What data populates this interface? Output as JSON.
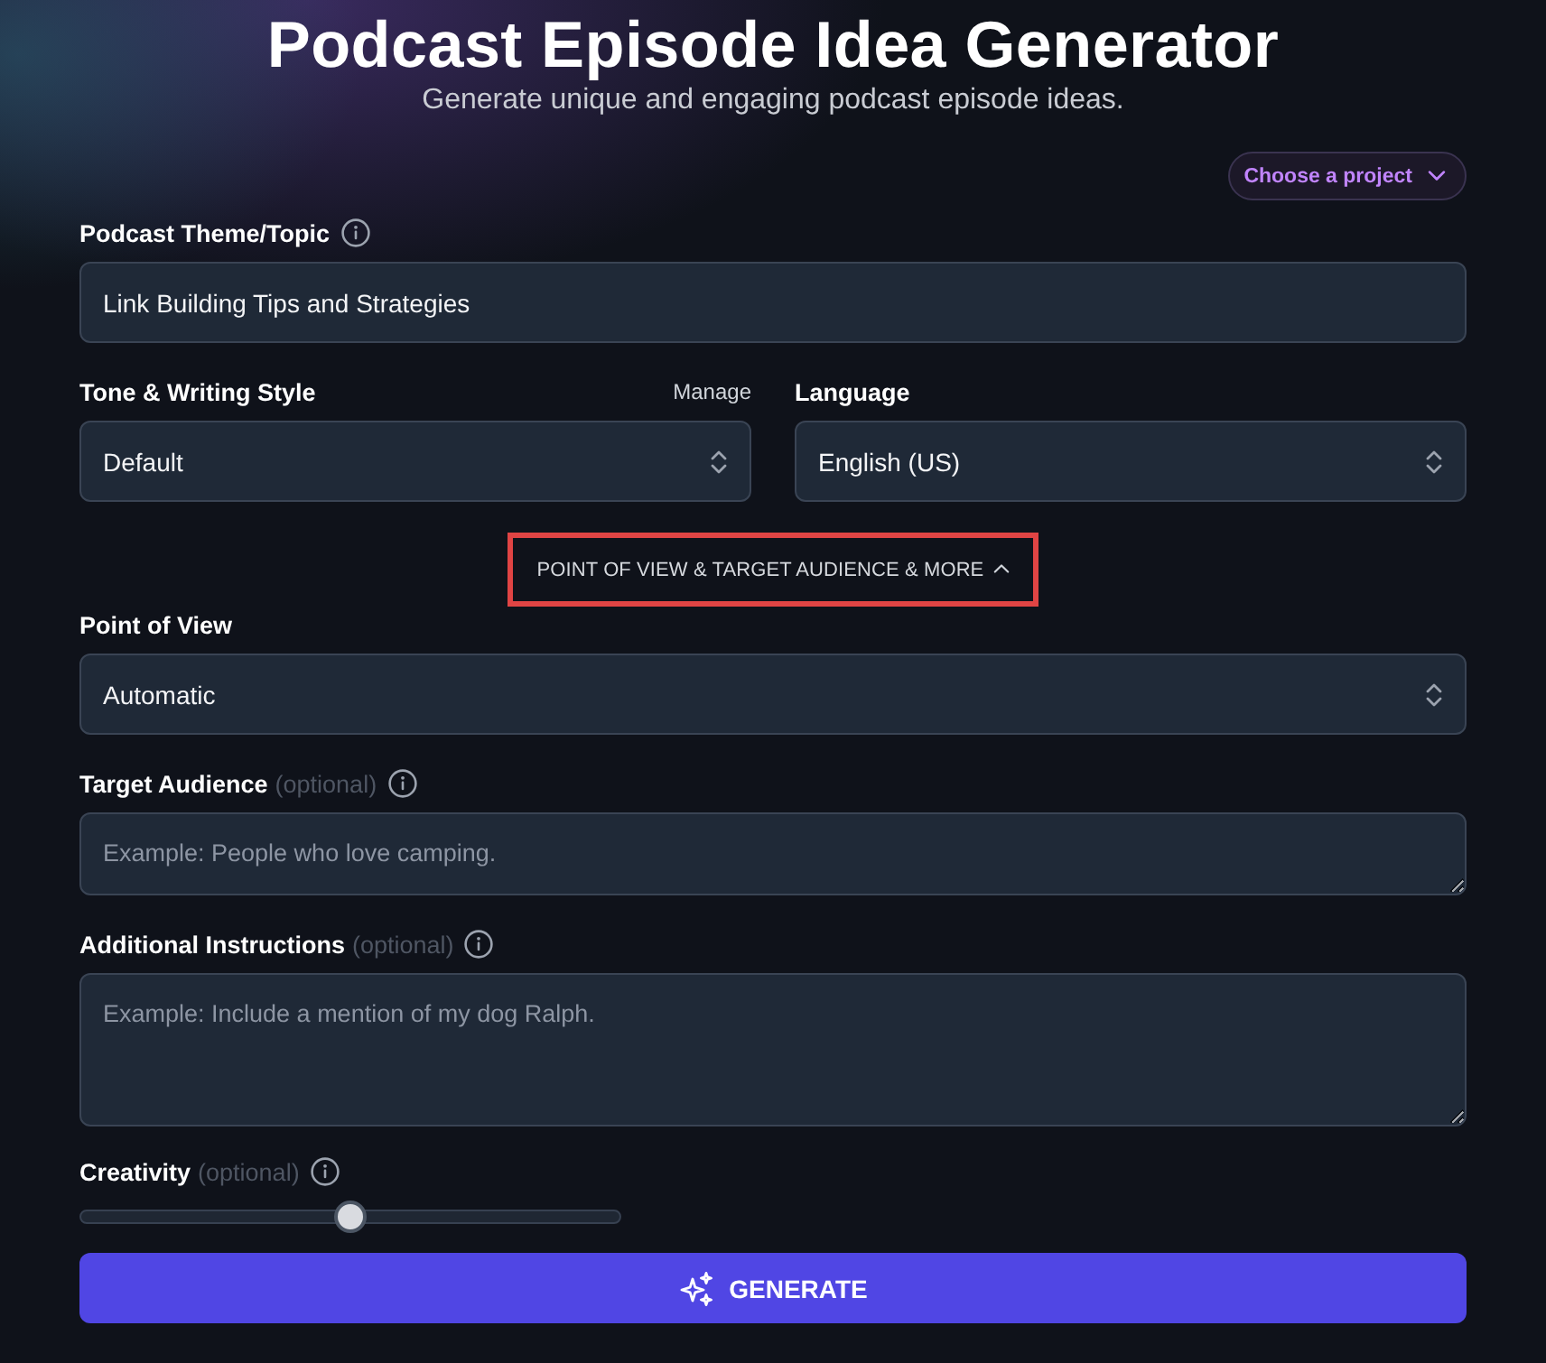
{
  "header": {
    "title": "Podcast Episode Idea Generator",
    "subtitle": "Generate unique and engaging podcast episode ideas."
  },
  "project_picker": {
    "label": "Choose a project"
  },
  "topic": {
    "label": "Podcast Theme/Topic",
    "info": true,
    "value": "Link Building Tips and Strategies"
  },
  "tone": {
    "label": "Tone & Writing Style",
    "action": "Manage",
    "value": "Default"
  },
  "language": {
    "label": "Language",
    "value": "English (US)"
  },
  "more_toggle": {
    "label": "POINT OF VIEW & TARGET AUDIENCE & MORE",
    "expanded": true,
    "highlighted": true
  },
  "point_of_view": {
    "label": "Point of View",
    "value": "Automatic"
  },
  "target_audience": {
    "label": "Target Audience",
    "hint": "(optional)",
    "info": true,
    "placeholder": "Example: People who love camping."
  },
  "additional_instructions": {
    "label": "Additional Instructions",
    "hint": "(optional)",
    "info": true,
    "placeholder": "Example: Include a mention of my dog Ralph."
  },
  "creativity": {
    "label": "Creativity",
    "hint": "(optional)",
    "info": true,
    "level": 0.5
  },
  "generate_button": {
    "label": "GENERATE"
  }
}
